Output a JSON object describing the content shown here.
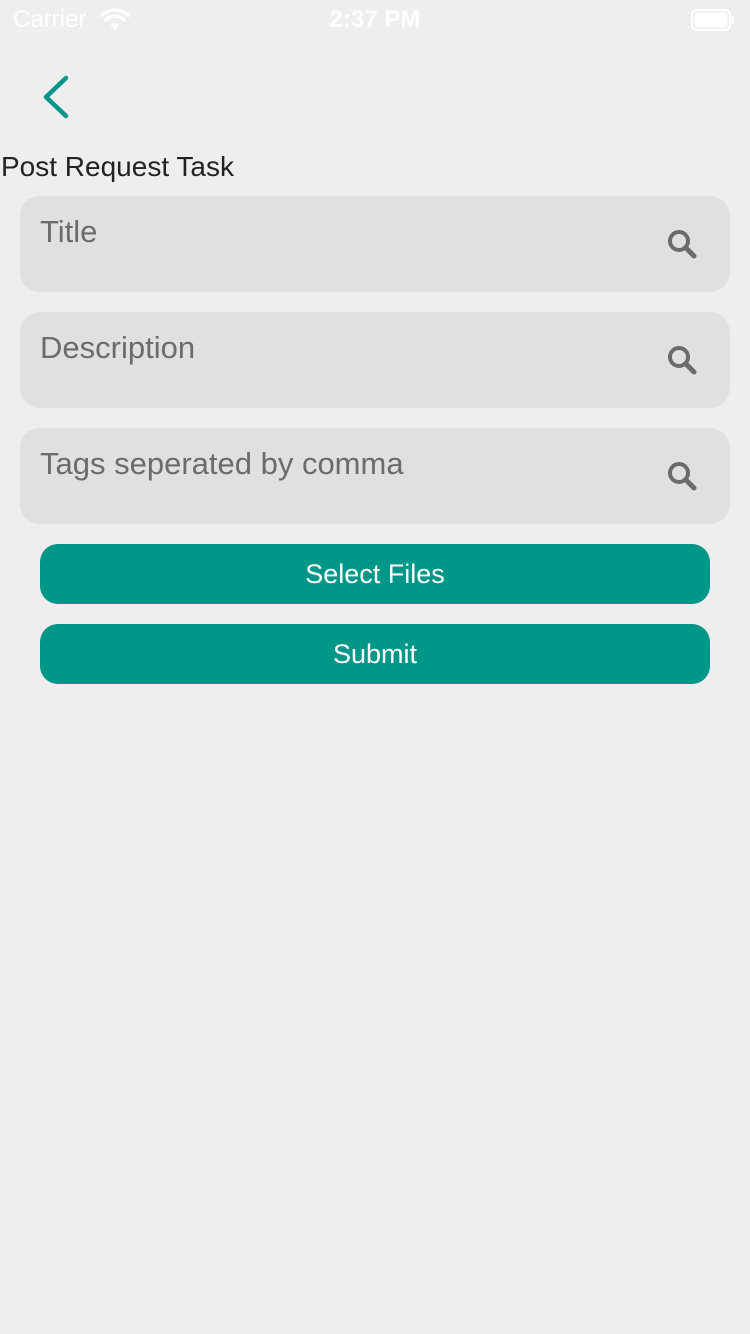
{
  "status_bar": {
    "carrier": "Carrier",
    "time": "2:37 PM",
    "wifi_icon": "wifi-icon",
    "battery_icon": "battery-icon"
  },
  "nav": {
    "back_icon": "chevron-left-icon"
  },
  "page": {
    "title": "Post Request Task"
  },
  "form": {
    "title_field": {
      "placeholder": "Title",
      "value": "",
      "icon": "search-icon"
    },
    "description_field": {
      "placeholder": "Description",
      "value": "",
      "icon": "search-icon"
    },
    "tags_field": {
      "placeholder": "Tags seperated by comma",
      "value": "",
      "icon": "search-icon"
    },
    "select_files_label": "Select Files",
    "submit_label": "Submit"
  },
  "colors": {
    "accent": "#009688",
    "background": "#eeeeee",
    "field_background": "#e0e0e0",
    "icon_gray": "#6b6b6b"
  }
}
